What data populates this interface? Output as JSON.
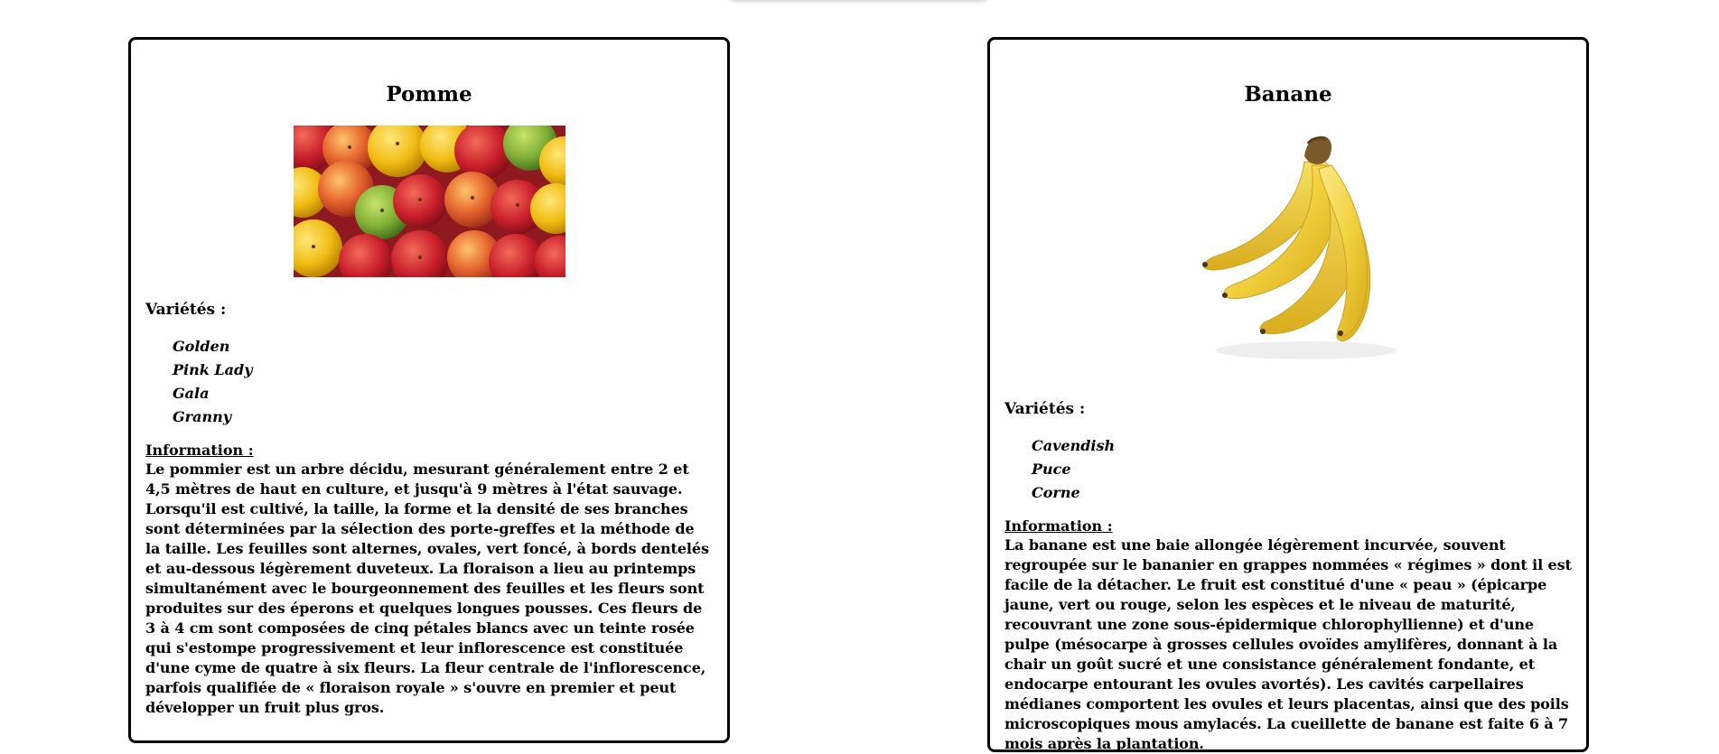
{
  "cards": [
    {
      "title": "Pomme",
      "varieties_label": "Variétés :",
      "varieties": [
        "Golden",
        "Pink Lady",
        "Gala",
        "Granny"
      ],
      "info_label": "Information :",
      "info_text": "Le pommier est un arbre décidu, mesurant généralement entre 2 et 4,5 mètres de haut en culture, et jusqu'à 9 mètres à l'état sauvage. Lorsqu'il est cultivé, la taille, la forme et la densité de ses branches sont déterminées par la sélection des porte-greffes et la méthode de la taille. Les feuilles sont alternes, ovales, vert foncé, à bords dentelés et au-dessous légèrement duveteux. La floraison a lieu au printemps simultanément avec le bourgeonnement des feuilles et les fleurs sont produites sur des éperons et quelques longues pousses. Ces fleurs de 3 à 4 cm sont composées de cinq pétales blancs avec un teinte rosée qui s'estompe progressivement et leur inflorescence est constituée d'une cyme de quatre à six fleurs. La fleur centrale de l'inflorescence, parfois qualifiée de « floraison royale » s'ouvre en premier et peut développer un fruit plus gros."
    },
    {
      "title": "Banane",
      "varieties_label": "Variétés :",
      "varieties": [
        "Cavendish",
        "Puce",
        "Corne"
      ],
      "info_label": "Information :",
      "info_text": "La banane est une baie allongée légèrement incurvée, souvent regroupée sur le bananier en grappes nommées « régimes » dont il est facile de la détacher. Le fruit est constitué d'une « peau » (épicarpe jaune, vert ou rouge, selon les espèces et le niveau de maturité, recouvrant une zone sous-épidermique chlorophyllienne) et d'une pulpe (mésocarpe à grosses cellules ovoïdes amylifères, donnant à la chair un goût sucré et une consistance généralement fondante, et endocarpe entourant les ovules avortés). Les cavités carpellaires médianes comportent les ovules et leurs placentas, ainsi que des poils microscopiques mous amylacés. La cueillette de banane est faite 6 à 7 mois après la plantation."
    }
  ],
  "colors": {
    "border": "#000000",
    "background": "#ffffff",
    "apple_red": "#c9262e",
    "apple_yellow": "#f2c21c",
    "apple_green": "#7fae35",
    "banana_yellow": "#f4d84e"
  }
}
